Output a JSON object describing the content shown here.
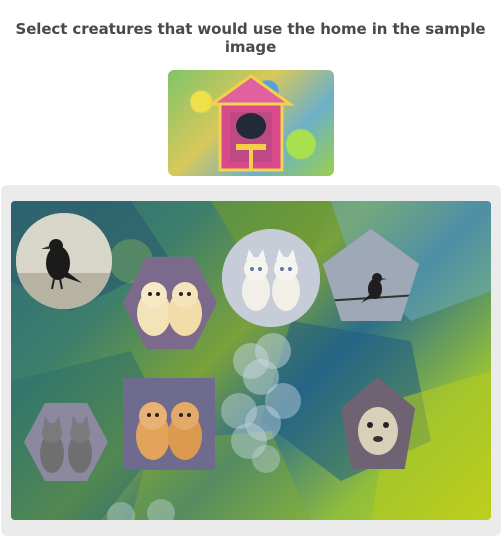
{
  "prompt": "Select creatures that would use the home in the sample image",
  "sample": {
    "icon": "birdhouse-icon"
  },
  "creatures": [
    {
      "name": "crow-circle",
      "icon": "crow-icon",
      "shape": "circle"
    },
    {
      "name": "puppies-hexagon",
      "icon": "puppies-icon",
      "shape": "hexagon"
    },
    {
      "name": "kittens-circle",
      "icon": "kittens-icon",
      "shape": "circle"
    },
    {
      "name": "bird-pentagon",
      "icon": "bird-on-wire-icon",
      "shape": "pentagon"
    },
    {
      "name": "puppies-square",
      "icon": "puppies-icon",
      "shape": "square"
    },
    {
      "name": "cats-hexagon",
      "icon": "cats-icon",
      "shape": "hexagon"
    },
    {
      "name": "animal-pentagon",
      "icon": "animal-face-icon",
      "shape": "pentagon"
    }
  ],
  "colors": {
    "panel": "#ebebeb",
    "prompt": "#4a4a4a"
  }
}
